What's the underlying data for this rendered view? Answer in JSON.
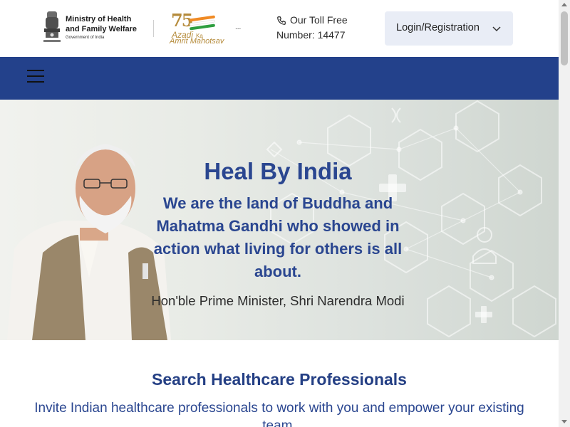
{
  "header": {
    "ministry_line1": "Ministry of Health",
    "ministry_line2": "and Family Welfare",
    "ministry_line3": "Government of India",
    "azadi_number": "75",
    "azadi_word1": "Azadi",
    "azadi_word2": "Ka",
    "azadi_word3": "Amrit Mahotsav",
    "ellipsis": "...",
    "toll_line1": "Our Toll Free",
    "toll_line2": "Number: 14477",
    "login_label": "Login/Registration"
  },
  "icons": {
    "emblem": "national-emblem-icon",
    "phone": "phone-icon",
    "chevron": "chevron-down-icon",
    "menu": "hamburger-menu-icon"
  },
  "hero": {
    "title": "Heal By India",
    "quote": "We are the land of Buddha and Mahatma Gandhi who showed in action what living for others is all about.",
    "attribution": "Hon'ble Prime Minister, Shri Narendra Modi"
  },
  "search_section": {
    "title": "Search Healthcare Professionals",
    "subtitle": "Invite Indian healthcare professionals to work with you and empower your existing team."
  },
  "colors": {
    "nav_bg": "#23418b",
    "accent_text": "#2a4690",
    "login_bg": "#e9edf6"
  }
}
